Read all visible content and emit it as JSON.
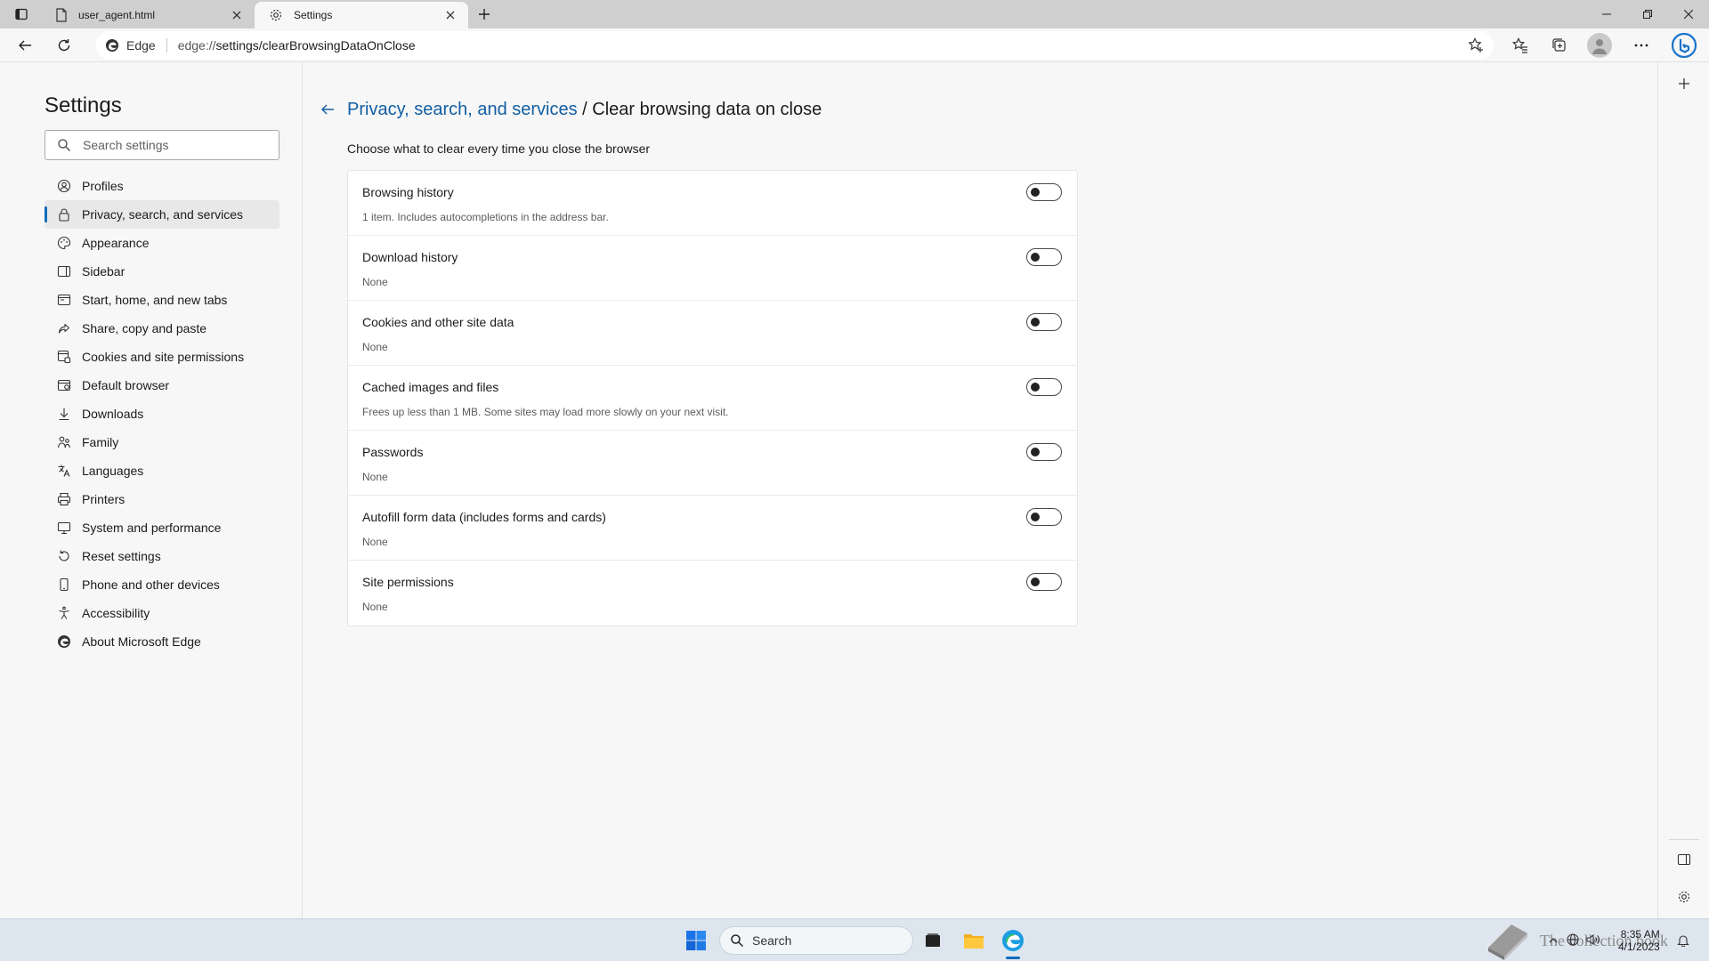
{
  "browser": {
    "tabs": [
      {
        "title": "user_agent.html",
        "active": false
      },
      {
        "title": "Settings",
        "active": true
      }
    ],
    "address": {
      "site_label": "Edge",
      "scheme": "edge://",
      "path": "settings/clearBrowsingDataOnClose"
    }
  },
  "sidebar": {
    "title": "Settings",
    "search_placeholder": "Search settings",
    "items": [
      {
        "label": "Profiles",
        "icon": "profile-icon"
      },
      {
        "label": "Privacy, search, and services",
        "icon": "lock-icon",
        "active": true
      },
      {
        "label": "Appearance",
        "icon": "appearance-icon"
      },
      {
        "label": "Sidebar",
        "icon": "sidebar-icon"
      },
      {
        "label": "Start, home, and new tabs",
        "icon": "home-icon"
      },
      {
        "label": "Share, copy and paste",
        "icon": "share-icon"
      },
      {
        "label": "Cookies and site permissions",
        "icon": "cookies-icon"
      },
      {
        "label": "Default browser",
        "icon": "browser-icon"
      },
      {
        "label": "Downloads",
        "icon": "download-icon"
      },
      {
        "label": "Family",
        "icon": "family-icon"
      },
      {
        "label": "Languages",
        "icon": "language-icon"
      },
      {
        "label": "Printers",
        "icon": "printer-icon"
      },
      {
        "label": "System and performance",
        "icon": "system-icon"
      },
      {
        "label": "Reset settings",
        "icon": "reset-icon"
      },
      {
        "label": "Phone and other devices",
        "icon": "phone-icon"
      },
      {
        "label": "Accessibility",
        "icon": "accessibility-icon"
      },
      {
        "label": "About Microsoft Edge",
        "icon": "edge-logo-icon"
      }
    ]
  },
  "main": {
    "breadcrumb_parent": "Privacy, search, and services",
    "breadcrumb_sep": " / ",
    "title": "Clear browsing data on close",
    "subtitle": "Choose what to clear every time you close the browser",
    "options": [
      {
        "title": "Browsing history",
        "description": "1 item. Includes autocompletions in the address bar.",
        "enabled": false
      },
      {
        "title": "Download history",
        "description": "None",
        "enabled": false
      },
      {
        "title": "Cookies and other site data",
        "description": "None",
        "enabled": false
      },
      {
        "title": "Cached images and files",
        "description": "Frees up less than 1 MB. Some sites may load more slowly on your next visit.",
        "enabled": false
      },
      {
        "title": "Passwords",
        "description": "None",
        "enabled": false
      },
      {
        "title": "Autofill form data (includes forms and cards)",
        "description": "None",
        "enabled": false
      },
      {
        "title": "Site permissions",
        "description": "None",
        "enabled": false
      }
    ]
  },
  "taskbar": {
    "search_label": "Search",
    "time": "8:35 AM",
    "date": "4/1/2023",
    "watermark_text": "The collection book"
  },
  "colors": {
    "accent": "#0f6cbd",
    "link": "#115ea3",
    "tab_strip": "#cfcfcf",
    "page_bg": "#f7f7f7"
  }
}
